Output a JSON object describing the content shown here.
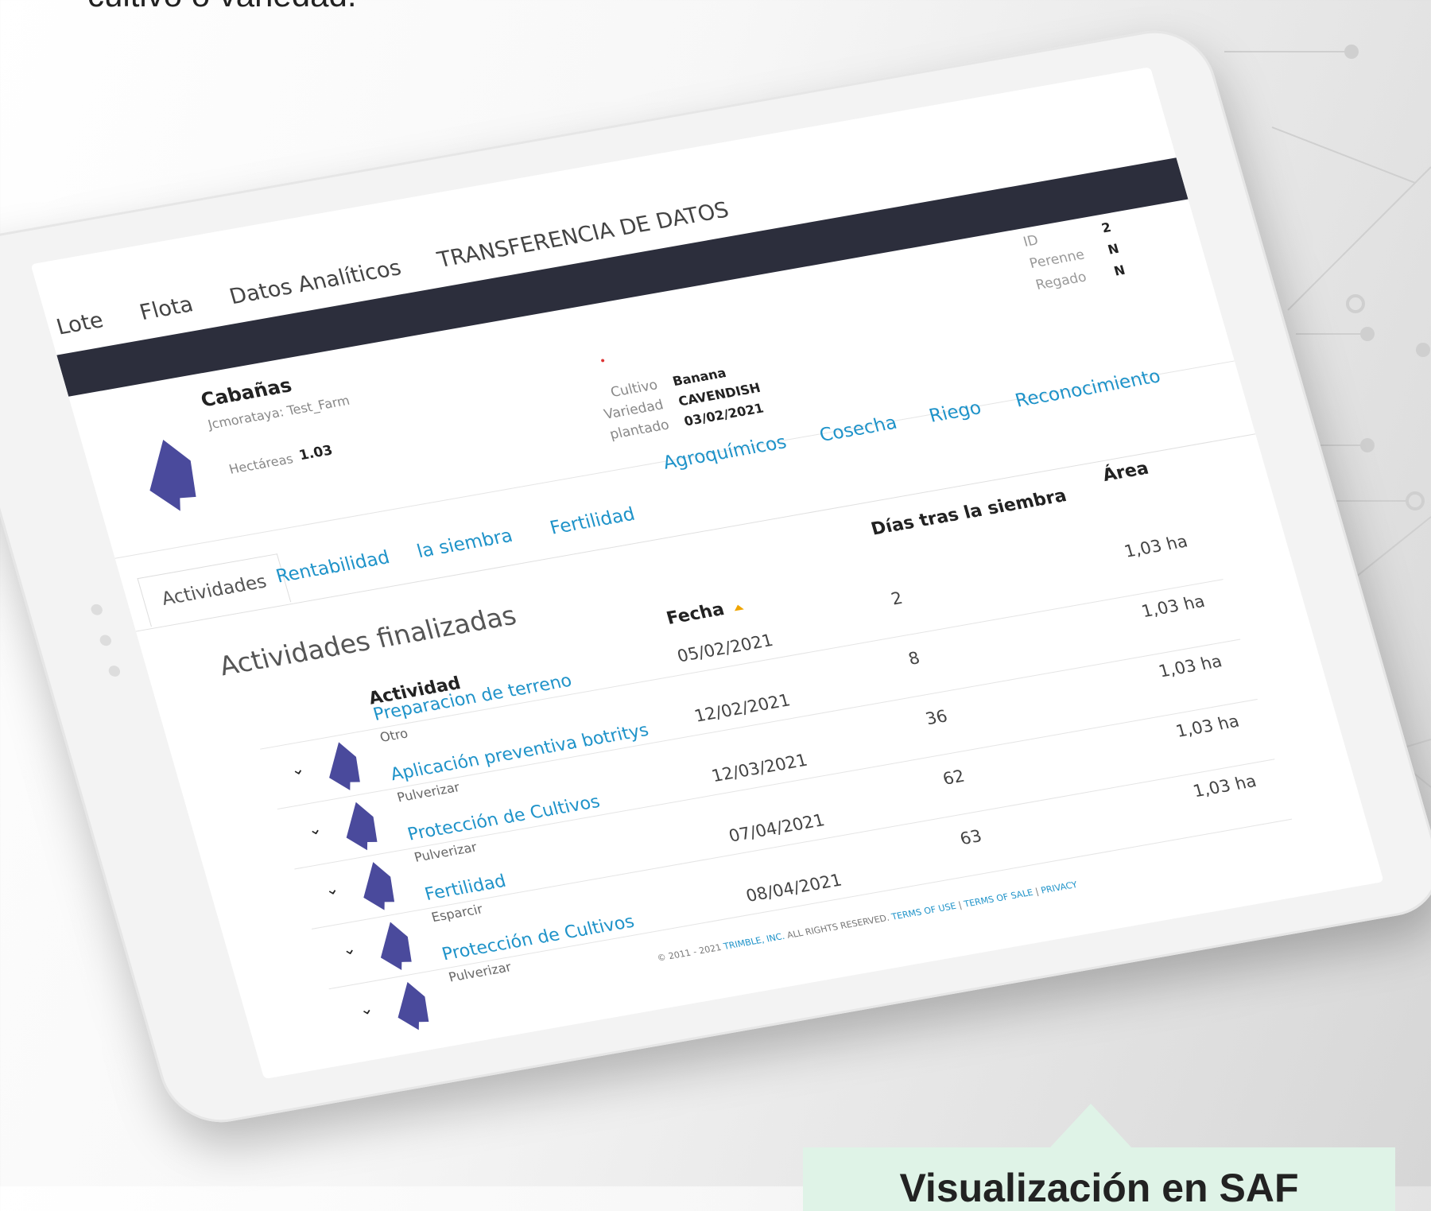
{
  "intro_text": "cultivo o variedad.",
  "nav": [
    "Lote",
    "Flota",
    "Datos Analíticos",
    "TRANSFERENCIA DE DATOS"
  ],
  "field": {
    "name": "Cabañas",
    "owner": "Jcmorataya: Test_Farm",
    "hectares_label": "Hectáreas",
    "hectares_value": "1.03",
    "crop_labels": [
      "Cultivo",
      "Variedad",
      "plantado"
    ],
    "crop_values": [
      "Banana",
      "CAVENDISH",
      "03/02/2021"
    ],
    "meta_labels": [
      "ID",
      "Perenne",
      "Regado"
    ],
    "meta_values": [
      "2",
      "N",
      "N"
    ]
  },
  "detail_links": [
    "Agroquímicos",
    "Cosecha",
    "Riego",
    "Reconocimiento"
  ],
  "tabs": [
    "Actividades",
    "Rentabilidad",
    "la siembra",
    "Fertilidad"
  ],
  "section_title": "Actividades finalizadas",
  "columns": {
    "activity": "Actividad",
    "date": "Fecha",
    "days": "Días tras la siembra",
    "area": "Área"
  },
  "rows": [
    {
      "name": "Preparacion de terreno",
      "type": "Otro",
      "date": "05/02/2021",
      "days": "2",
      "area": "1,03 ha"
    },
    {
      "name": "Aplicación preventiva botritys",
      "type": "Pulverizar",
      "date": "12/02/2021",
      "days": "8",
      "area": "1,03 ha"
    },
    {
      "name": "Protección de Cultivos",
      "type": "Pulverizar",
      "date": "12/03/2021",
      "days": "36",
      "area": "1,03 ha"
    },
    {
      "name": "Fertilidad",
      "type": "Esparcir",
      "date": "07/04/2021",
      "days": "62",
      "area": "1,03 ha"
    },
    {
      "name": "Protección de Cultivos",
      "type": "Pulverizar",
      "date": "08/04/2021",
      "days": "63",
      "area": "1,03 ha"
    }
  ],
  "footer": {
    "copyright": "© 2011 - 2021",
    "company": "TRIMBLE, INC.",
    "rights": "ALL RIGHTS RESERVED.",
    "links": [
      "TERMS OF USE",
      "TERMS OF SALE",
      "PRIVACY"
    ]
  },
  "caption": "Visualización en SAF",
  "colors": {
    "link": "#1f93c9",
    "header_bar": "#2c2e3c",
    "field_shape": "#4a4a9c",
    "caption_bg": "#dff3e7",
    "sort_arrow": "#f0a500"
  }
}
